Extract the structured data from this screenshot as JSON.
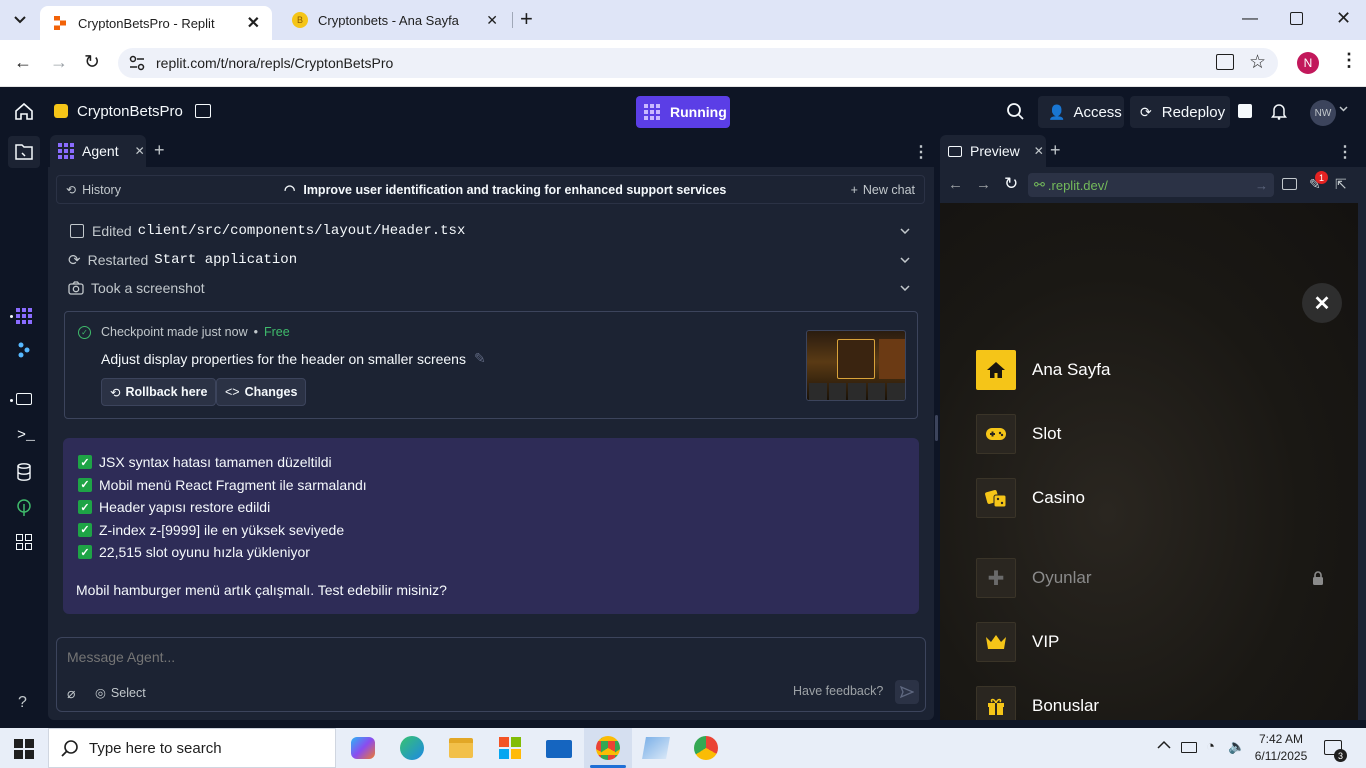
{
  "browser": {
    "tabs": [
      {
        "title": "CryptonBetsPro - Replit"
      },
      {
        "title": "Cryptonbets - Ana Sayfa"
      }
    ],
    "url": "replit.com/t/nora/repls/CryptonBetsPro",
    "profile_initial": "N"
  },
  "replit": {
    "project_name": "CryptonBetsPro",
    "run_status": "Running",
    "access_label": "Access",
    "redeploy_label": "Redeploy",
    "user_initials": "NW"
  },
  "agent": {
    "tab_label": "Agent",
    "history_label": "History",
    "chat_title": "Improve user identification and tracking for enhanced support services",
    "new_chat_label": "New chat",
    "steps": [
      {
        "verb": "Edited",
        "target": "client/src/components/layout/Header.tsx"
      },
      {
        "verb": "Restarted",
        "target": "Start application"
      },
      {
        "verb": "Took a screenshot",
        "target": ""
      }
    ],
    "checkpoint": {
      "label": "Checkpoint made just now",
      "separator": "•",
      "tag": "Free",
      "description": "Adjust display properties for the header on smaller screens",
      "rollback_label": "Rollback here",
      "changes_label": "Changes"
    },
    "message": {
      "checks": [
        "JSX syntax hatası tamamen düzeltildi",
        "Mobil menü React Fragment ile sarmalandı",
        "Header yapısı restore edildi",
        "Z-index z-[9999] ile en yüksek seviyede",
        "22,515 slot oyunu hızla yükleniyor"
      ],
      "question": "Mobil hamburger menü artık çalışmalı. Test edebilir misiniz?"
    },
    "input": {
      "placeholder": "Message Agent...",
      "select_label": "Select",
      "feedback_label": "Have feedback?"
    }
  },
  "preview": {
    "tab_label": "Preview",
    "url": ".replit.dev/",
    "notification_count": "1",
    "menu": [
      {
        "label": "Ana Sayfa",
        "icon": "home-icon",
        "active": true
      },
      {
        "label": "Slot",
        "icon": "gamepad-icon",
        "active": false
      },
      {
        "label": "Casino",
        "icon": "dice-icon",
        "active": false
      },
      {
        "label": "Oyunlar",
        "icon": "puzzle-icon",
        "active": false,
        "locked": true
      },
      {
        "label": "VIP",
        "icon": "crown-icon",
        "active": false
      },
      {
        "label": "Bonuslar",
        "icon": "gift-icon",
        "active": false
      }
    ],
    "accent_color": "#f5c518"
  },
  "taskbar": {
    "search_placeholder": "Type here to search",
    "time": "7:42 AM",
    "date": "6/11/2025",
    "notification_count": "3"
  }
}
